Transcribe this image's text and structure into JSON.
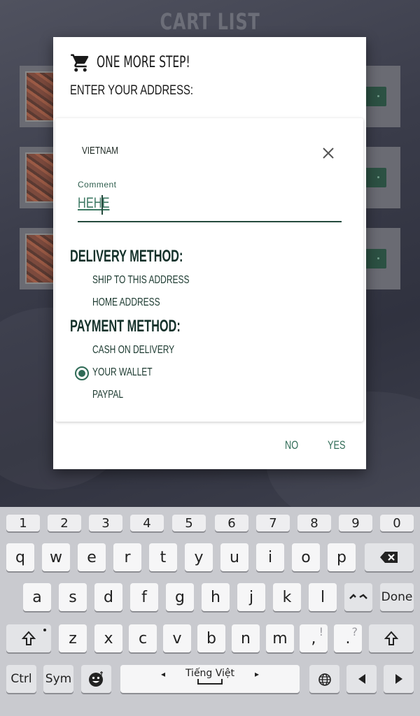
{
  "app": {
    "title": "CART LIST"
  },
  "dialog": {
    "title": "ONE MORE STEP!",
    "subtitle": "ENTER YOUR ADDRESS:",
    "country": "VIETNAM",
    "comment_label": "Comment",
    "comment_value": "HEHE",
    "delivery_heading": "DELIVERY METHOD:",
    "delivery_options": [
      "SHIP TO THIS ADDRESS",
      "HOME ADDRESS"
    ],
    "payment_heading": "PAYMENT METHOD:",
    "payment_options": [
      "CASH ON DELIVERY",
      "YOUR WALLET",
      "PAYPAL"
    ],
    "selected_payment": "YOUR WALLET",
    "no_label": "NO",
    "yes_label": "YES",
    "accent_color": "#2f6b56"
  },
  "keyboard": {
    "row_numbers": [
      "1",
      "2",
      "3",
      "4",
      "5",
      "6",
      "7",
      "8",
      "9",
      "0"
    ],
    "row_1": [
      "q",
      "w",
      "e",
      "r",
      "t",
      "y",
      "u",
      "i",
      "o",
      "p"
    ],
    "row_2": [
      "a",
      "s",
      "d",
      "f",
      "g",
      "h",
      "j",
      "k",
      "l"
    ],
    "row_3": [
      "z",
      "x",
      "c",
      "v",
      "b",
      "n",
      "m"
    ],
    "comma": ",",
    "comma_alt": "!",
    "period": ".",
    "period_alt": "?",
    "done_label": "Done",
    "ctrl_label": "Ctrl",
    "sym_label": "Sym",
    "space_label": "Tiếng Việt",
    "icons": [
      "backspace-icon",
      "shift-icon",
      "emoji-icon",
      "globe-icon",
      "left-arrow-icon",
      "right-arrow-icon"
    ]
  }
}
